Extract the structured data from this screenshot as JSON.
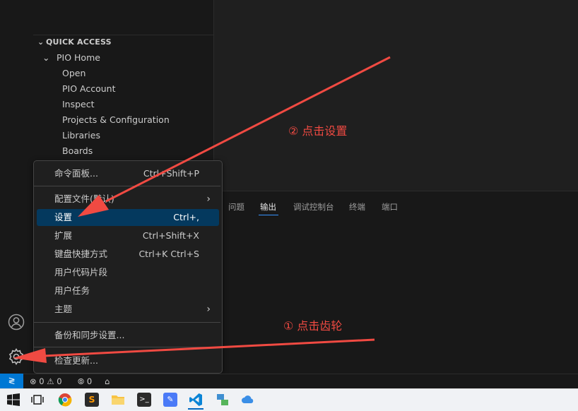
{
  "sidebar": {
    "section_title": "QUICK ACCESS",
    "tree": [
      {
        "label": "PIO Home",
        "expanded": true
      },
      {
        "label": "Open"
      },
      {
        "label": "PIO Account"
      },
      {
        "label": "Inspect"
      },
      {
        "label": "Projects & Configuration"
      },
      {
        "label": "Libraries"
      },
      {
        "label": "Boards"
      }
    ]
  },
  "panel": {
    "tabs": [
      "问题",
      "输出",
      "调试控制台",
      "终端",
      "端口"
    ],
    "active_tab": "输出"
  },
  "menu": {
    "items": [
      {
        "label": "命令面板...",
        "shortcut": "Ctrl+Shift+P"
      },
      {
        "label": "配置文件(默认)",
        "submenu": true
      },
      {
        "label": "设置",
        "shortcut": "Ctrl+,",
        "selected": true
      },
      {
        "label": "扩展",
        "shortcut": "Ctrl+Shift+X"
      },
      {
        "label": "键盘快捷方式",
        "shortcut": "Ctrl+K Ctrl+S"
      },
      {
        "label": "用户代码片段"
      },
      {
        "label": "用户任务"
      },
      {
        "label": "主题",
        "submenu": true
      },
      {
        "label": "备份和同步设置..."
      },
      {
        "label": "检查更新..."
      }
    ]
  },
  "status_bar": {
    "errors": "0",
    "warnings": "0",
    "ports": "0"
  },
  "annotations": {
    "step1": "① 点击齿轮",
    "step2": "② 点击设置"
  },
  "colors": {
    "accent": "#0078d4",
    "menu_selection": "#04395e",
    "annotation": "#f04a42"
  },
  "icons": {
    "account": "account-icon",
    "manage": "gear-icon",
    "remote": "remote-icon"
  }
}
